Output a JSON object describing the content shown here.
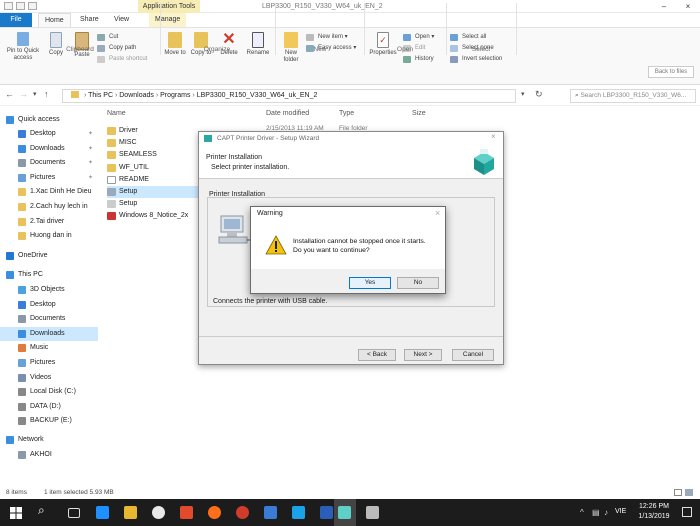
{
  "window": {
    "app_tools_label": "Application Tools",
    "title": "LBP3300_R150_V330_W64_uk_EN_2",
    "minimize": "–",
    "close": "×"
  },
  "tabs": [
    {
      "label": "File"
    },
    {
      "label": "Home"
    },
    {
      "label": "Share"
    },
    {
      "label": "View"
    },
    {
      "label": "Manage"
    }
  ],
  "ribbon": {
    "clipboard": {
      "pin_label": "Pin to Quick access",
      "copy_label": "Copy",
      "paste_label": "Paste",
      "cut_label": "Cut",
      "copy_path_label": "Copy path",
      "paste_shortcut_label": "Paste shortcut",
      "group_label": "Clipboard"
    },
    "organize": {
      "move_label": "Move to",
      "copy_label": "Copy to",
      "delete_label": "Delete",
      "rename_label": "Rename",
      "group_label": "Organize"
    },
    "new": {
      "new_folder_label": "New folder",
      "new_item_label": "New item",
      "easy_access_label": "Easy access",
      "group_label": "New"
    },
    "open": {
      "properties_label": "Properties",
      "open_label": "Open",
      "edit_label": "Edit",
      "history_label": "History",
      "group_label": "Open"
    },
    "select": {
      "select_all_label": "Select all",
      "select_none_label": "Select none",
      "invert_label": "Invert selection",
      "group_label": "Select"
    },
    "tooltip": "Back to files"
  },
  "address": {
    "path": [
      "This PC",
      "Downloads",
      "Programs",
      "LBP3300_R150_V330_W64_uk_EN_2"
    ],
    "search_placeholder": "Search LBP3300_R150_V330_W6..."
  },
  "nav": {
    "quick_access": "Quick access",
    "quick_items": [
      "Desktop",
      "Downloads",
      "Documents",
      "Pictures",
      "1.Xac Dinh He Dieu",
      "2.Cach huy lech in",
      "2.Tai driver",
      "Huong dan in"
    ],
    "onedrive": "OneDrive",
    "this_pc": "This PC",
    "pc_items": [
      "3D Objects",
      "Desktop",
      "Documents",
      "Downloads",
      "Music",
      "Pictures",
      "Videos",
      "Local Disk (C:)",
      "DATA (D:)",
      "BACKUP (E:)"
    ],
    "network": "Network",
    "network_items": [
      "AKHOI"
    ]
  },
  "columns": {
    "name": "Name",
    "date": "Date modified",
    "type": "Type",
    "size": "Size"
  },
  "files": [
    {
      "name": "Driver",
      "date": "2/15/2013 11:19 AM",
      "type": "File folder"
    },
    {
      "name": "MISC"
    },
    {
      "name": "SEAMLESS"
    },
    {
      "name": "WF_UTIL"
    },
    {
      "name": "README"
    },
    {
      "name": "Setup"
    },
    {
      "name": "Setup"
    },
    {
      "name": "Windows 8_Notice_2x"
    }
  ],
  "status": {
    "items": "8 items",
    "selected": "1 item selected  5.93 MB"
  },
  "wizard": {
    "title": "CAPT Printer Driver - Setup Wizard",
    "heading": "Printer Installation",
    "subheading": "Select printer installation.",
    "group_label": "Printer Installation",
    "usb_text": "Connects the printer with USB cable.",
    "back_label": "< Back",
    "next_label": "Next >",
    "cancel_label": "Cancel"
  },
  "warning": {
    "title": "Warning",
    "line1": "Installation cannot be stopped once it starts.",
    "line2": "Do you want to continue?",
    "yes_label": "Yes",
    "no_label": "No"
  },
  "taskbar": {
    "lang": "VIE",
    "time": "12:26 PM",
    "date": "1/13/2019"
  },
  "colors": {
    "accent": "#1979ca",
    "manage_tab": "#fbf3cc",
    "selection": "#cce8ff",
    "taskbar": "#1c1c1c"
  }
}
